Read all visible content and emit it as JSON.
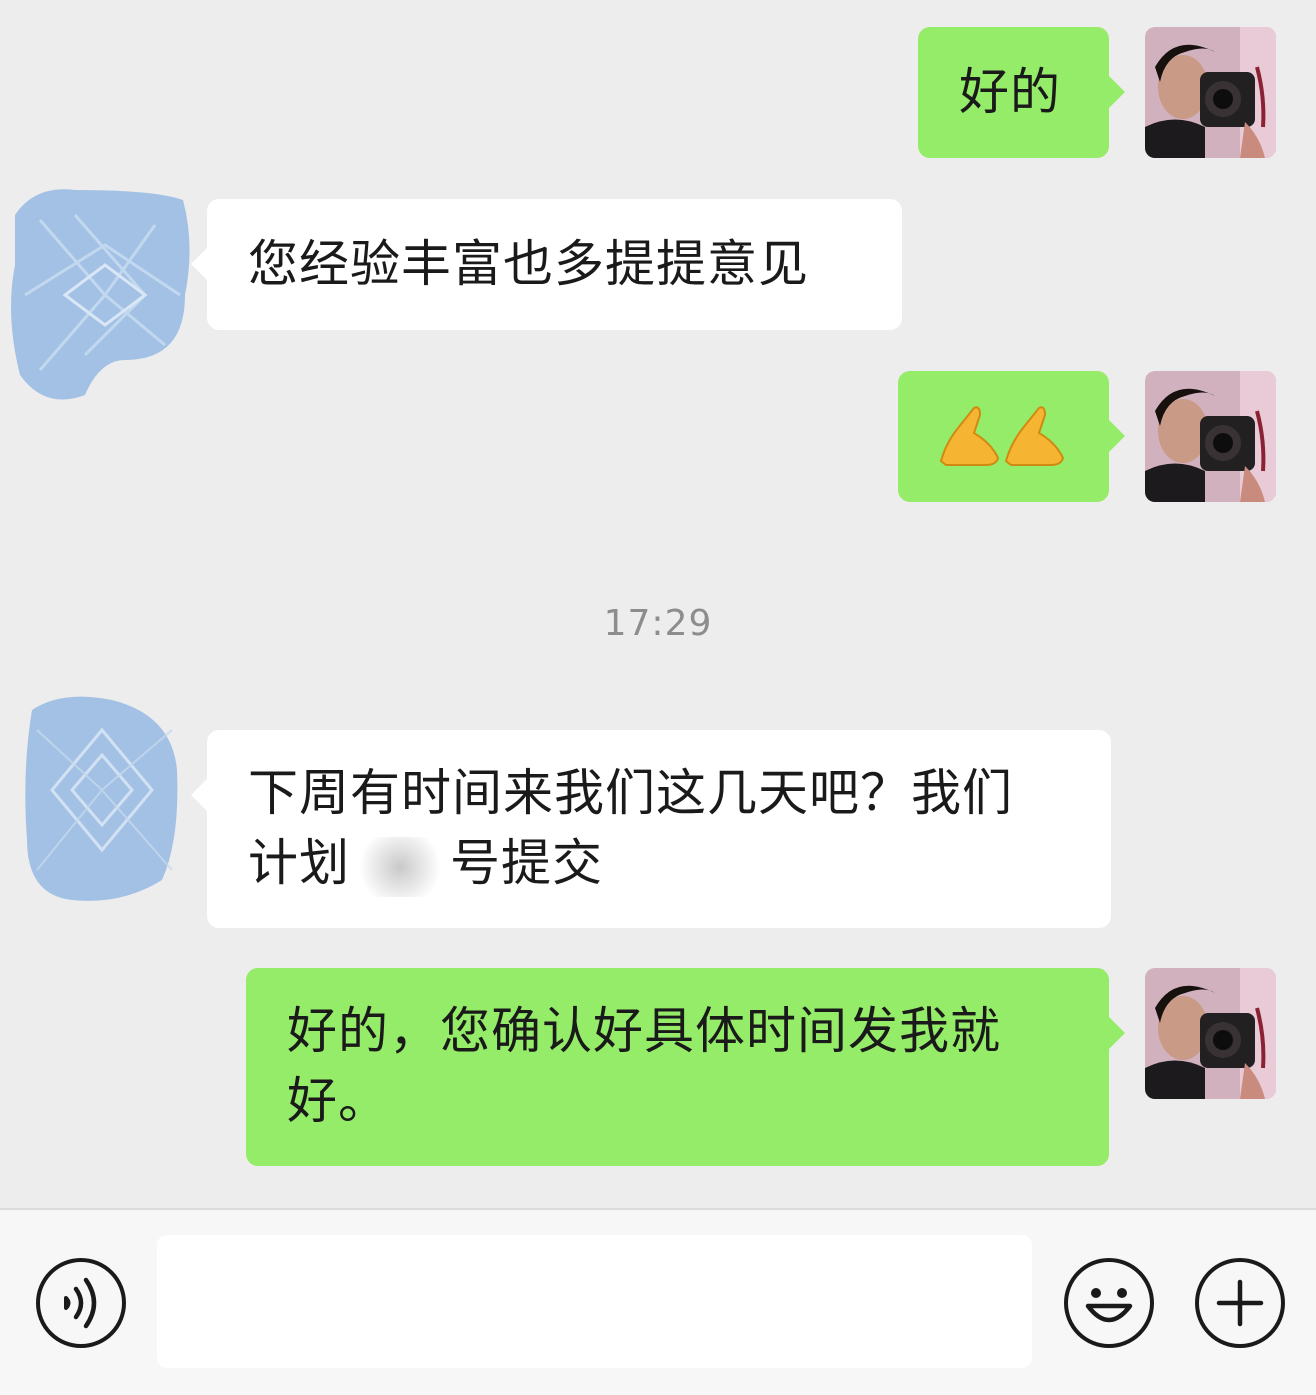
{
  "messages": [
    {
      "side": "me",
      "text": "好的"
    },
    {
      "side": "other",
      "text": "您经验丰富也多提提意见"
    },
    {
      "side": "me",
      "text": "🙏🙏"
    },
    {
      "side": "other",
      "text_line1": "下周有时间来我们这几天吧？我们",
      "text_line2_a": "计划",
      "text_line2_b": "号提交"
    },
    {
      "side": "me",
      "text_line1": "好的，您确认好具体时间发我就",
      "text_line2": "好。"
    }
  ],
  "timestamp": "17:29",
  "colors": {
    "background": "#ededed",
    "my_bubble": "#95ec69",
    "their_bubble": "#ffffff",
    "redacted_avatar": "#a3c1e4"
  },
  "input": {
    "placeholder": ""
  },
  "icons": {
    "voice": "voice-icon",
    "emoji": "emoji-icon",
    "plus": "plus-icon"
  }
}
